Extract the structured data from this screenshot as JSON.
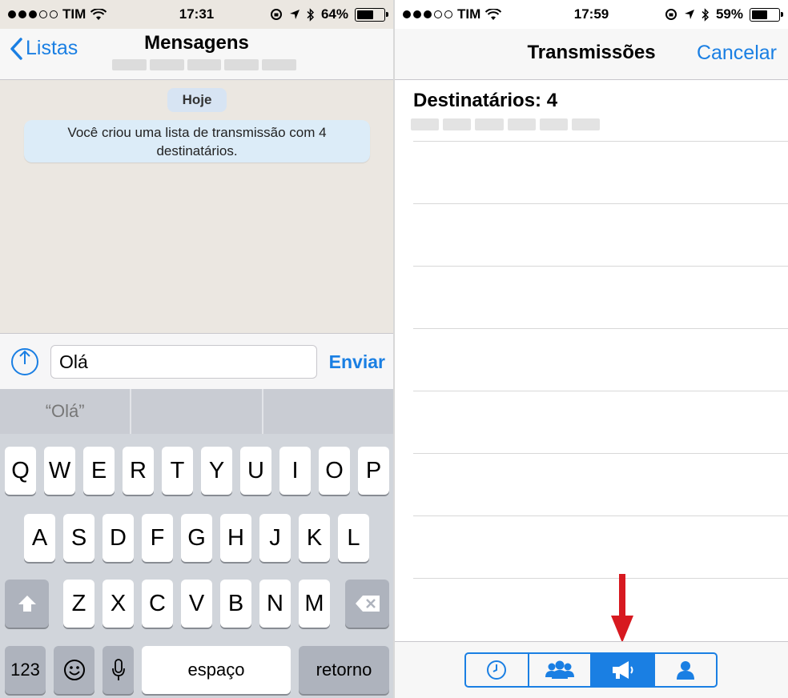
{
  "left": {
    "status": {
      "carrier": "TIM",
      "time": "17:31",
      "battery": "64%",
      "battery_level": 0.64
    },
    "nav": {
      "back_label": "Listas",
      "title": "Mensagens"
    },
    "chat": {
      "date_label": "Hoje",
      "system_message": "Você criou uma lista de transmissão com 4 destinatários."
    },
    "input": {
      "value": "Olá",
      "send_label": "Enviar"
    },
    "suggestions": [
      "“Olá”",
      "",
      ""
    ],
    "keyboard": {
      "row1": [
        "Q",
        "W",
        "E",
        "R",
        "T",
        "Y",
        "U",
        "I",
        "O",
        "P"
      ],
      "row2": [
        "A",
        "S",
        "D",
        "F",
        "G",
        "H",
        "J",
        "K",
        "L"
      ],
      "row3": [
        "Z",
        "X",
        "C",
        "V",
        "B",
        "N",
        "M"
      ],
      "numbers_key": "123",
      "space_key": "espaço",
      "return_key": "retorno"
    }
  },
  "right": {
    "status": {
      "carrier": "TIM",
      "time": "17:59",
      "battery": "59%",
      "battery_level": 0.59
    },
    "nav": {
      "title": "Transmissões",
      "cancel_label": "Cancelar"
    },
    "recipients_label": "Destinatários: 4",
    "toolbar": {
      "tabs": [
        "clock-icon",
        "group-icon",
        "megaphone-icon",
        "person-icon"
      ],
      "active_tab": 2
    }
  },
  "colors": {
    "accent": "#1a7fe3",
    "chat_background": "#ebe7e1",
    "arrow": "#d71920"
  }
}
